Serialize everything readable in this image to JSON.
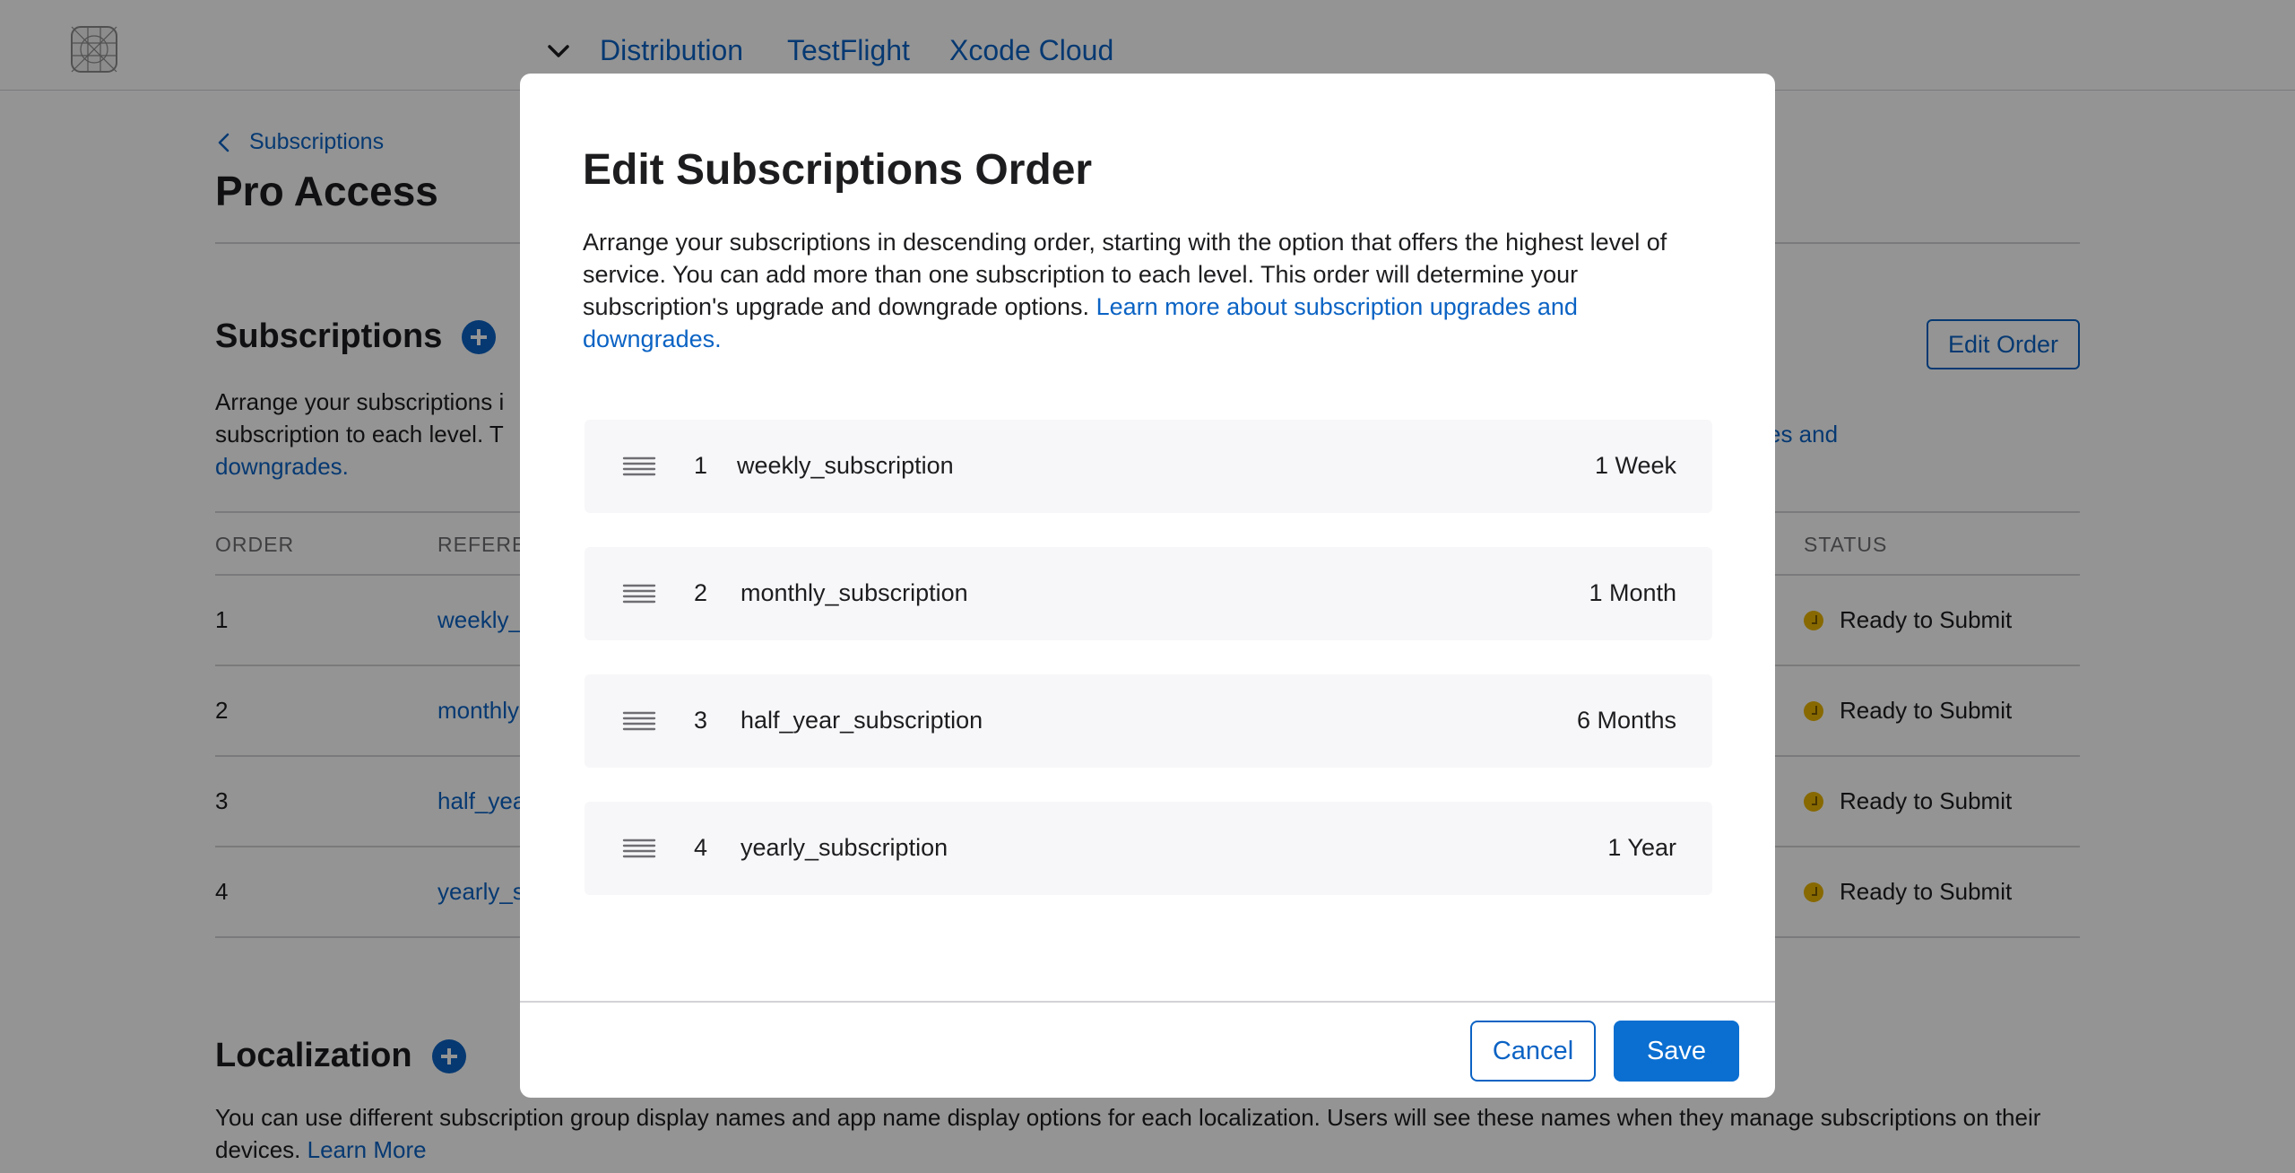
{
  "header": {
    "nav": [
      "Distribution",
      "TestFlight",
      "Xcode Cloud"
    ]
  },
  "page": {
    "breadcrumb": "Subscriptions",
    "title": "Pro Access",
    "subscriptions_section": {
      "title": "Subscriptions",
      "edit_order_label": "Edit Order",
      "description_visible_start": "Arrange your subscriptions i",
      "description_visible_line2": "subscription to each level. T",
      "description_link_tail": "es and",
      "description_link_line2": "downgrades.",
      "columns": [
        "ORDER",
        "REFEREN",
        "STATUS"
      ],
      "rows": [
        {
          "order": "1",
          "reference": "weekly_",
          "status": "Ready to Submit"
        },
        {
          "order": "2",
          "reference": "monthly",
          "status": "Ready to Submit"
        },
        {
          "order": "3",
          "reference": "half_yea",
          "status": "Ready to Submit"
        },
        {
          "order": "4",
          "reference": "yearly_s",
          "status": "Ready to Submit"
        }
      ]
    },
    "localization_section": {
      "title": "Localization",
      "description": "You can use different subscription group display names and app name display options for each localization. Users will see these names when they manage subscriptions on their devices.",
      "learn_more": "Learn More"
    }
  },
  "modal": {
    "title": "Edit Subscriptions Order",
    "description": "Arrange your subscriptions in descending order, starting with the option that offers the highest level of service. You can add more than one subscription to each level. This order will determine your subscription's upgrade and downgrade options.",
    "link": "Learn more about subscription upgrades and downgrades.",
    "items": [
      {
        "num": "1",
        "name": "weekly_subscription",
        "duration": "1 Week"
      },
      {
        "num": "2",
        "name": "monthly_subscription",
        "duration": "1 Month"
      },
      {
        "num": "3",
        "name": "half_year_subscription",
        "duration": "6 Months"
      },
      {
        "num": "4",
        "name": "yearly_subscription",
        "duration": "1 Year"
      }
    ],
    "cancel_label": "Cancel",
    "save_label": "Save"
  },
  "colors": {
    "accent": "#0b63c4",
    "primary_button": "#0b6fd1",
    "status_ready": "#e8b600",
    "overlay": "rgba(0,0,0,0.42)"
  },
  "icons": {
    "logo": "app-icon-grid",
    "drag": "drag-handle-icon",
    "chevron": "chevron-down-icon",
    "back": "chevron-left-icon",
    "add": "plus-circle-icon",
    "status": "clock-icon"
  }
}
